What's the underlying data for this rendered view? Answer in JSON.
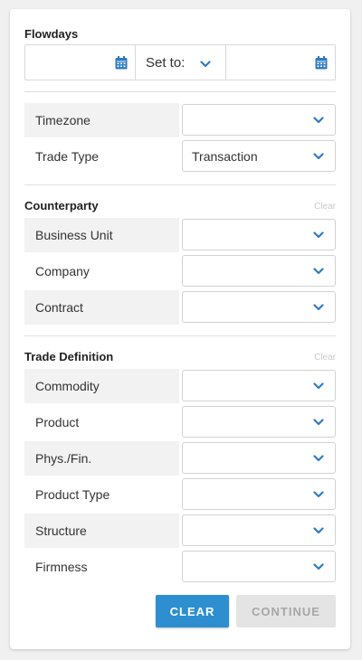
{
  "flowdays": {
    "title": "Flowdays",
    "start_date_value": "",
    "set_to_label": "Set to:",
    "end_date_value": "",
    "accent_color": "#2e7bc4"
  },
  "general": {
    "timezone": {
      "label": "Timezone",
      "value": ""
    },
    "trade_type": {
      "label": "Trade Type",
      "value": "Transaction"
    }
  },
  "counterparty": {
    "title": "Counterparty",
    "clear_label": "Clear",
    "fields": [
      {
        "label": "Business Unit",
        "value": ""
      },
      {
        "label": "Company",
        "value": ""
      },
      {
        "label": "Contract",
        "value": ""
      }
    ]
  },
  "trade_definition": {
    "title": "Trade Definition",
    "clear_label": "Clear",
    "fields": [
      {
        "label": "Commodity",
        "value": ""
      },
      {
        "label": "Product",
        "value": ""
      },
      {
        "label": "Phys./Fin.",
        "value": ""
      },
      {
        "label": "Product Type",
        "value": ""
      },
      {
        "label": "Structure",
        "value": ""
      },
      {
        "label": "Firmness",
        "value": ""
      }
    ]
  },
  "actions": {
    "clear_label": "CLEAR",
    "continue_label": "CONTINUE"
  }
}
